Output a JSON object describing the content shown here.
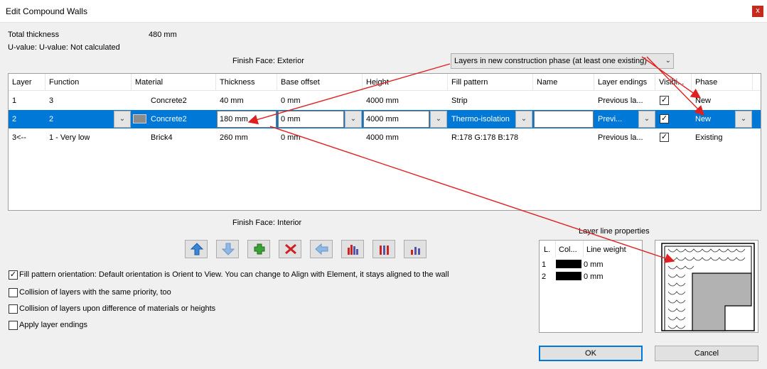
{
  "window": {
    "title": "Edit Compound Walls",
    "close_label": "x"
  },
  "summary": {
    "total_thickness_label": "Total thickness",
    "total_thickness_value": "480 mm",
    "uvalue_text": "U-value: U-value: Not calculated"
  },
  "finish_exterior": "Finish Face: Exterior",
  "finish_interior": "Finish Face: Interior",
  "phase_combo": {
    "value": "Layers in new construction phase (at least one existing)"
  },
  "table": {
    "headers": [
      "Layer",
      "Function",
      "Material",
      "Thickness",
      "Base offset",
      "Height",
      "Fill pattern",
      "Name",
      "Layer endings",
      "Visibi...",
      "Phase"
    ],
    "rows": [
      {
        "layer": "1",
        "function": "3",
        "material": "Concrete2",
        "thickness": "40 mm",
        "base_offset": "0 mm",
        "height": "4000 mm",
        "fill": "Strip",
        "name": "",
        "endings": "Previous la...",
        "visible": true,
        "phase": "New"
      },
      {
        "layer": "2",
        "function": "2",
        "material": "Concrete2",
        "thickness": "180 mm",
        "base_offset": "0 mm",
        "height": "4000 mm",
        "fill": "Thermo-isolation",
        "name": "",
        "endings": "Previ...",
        "visible": true,
        "phase": "New"
      },
      {
        "layer": "3<--",
        "function": "1 - Very low",
        "material": "Brick4",
        "thickness": "260 mm",
        "base_offset": "0 mm",
        "height": "4000 mm",
        "fill": "R:178 G:178 B:178",
        "name": "",
        "endings": "Previous la...",
        "visible": true,
        "phase": "Existing"
      }
    ]
  },
  "toolbar": {
    "icons": [
      "move-up-icon",
      "move-down-icon",
      "add-layer-icon",
      "delete-layer-icon",
      "back-arrow-icon",
      "layers-chart-icon",
      "layers-bars-icon",
      "layers-small-chart-icon"
    ]
  },
  "options": [
    {
      "label": "Fill pattern orientation: Default orientation is Orient to View. You can change to Align with Element, it stays aligned to the wall",
      "checked": true
    },
    {
      "label": "Collision of layers with the same priority, too",
      "checked": false
    },
    {
      "label": "Collision of layers upon difference of materials or heights",
      "checked": false
    },
    {
      "label": "Apply layer endings",
      "checked": false
    }
  ],
  "layer_line": {
    "title": "Layer line properties",
    "headers": [
      "L.",
      "Col...",
      "Line weight"
    ],
    "rows": [
      {
        "layer": "1",
        "weight": "0 mm"
      },
      {
        "layer": "2",
        "weight": "0 mm"
      }
    ]
  },
  "buttons": {
    "ok": "OK",
    "cancel": "Cancel"
  },
  "colors": {
    "selection": "#0078d7",
    "annotation_arrow": "#e02020"
  }
}
